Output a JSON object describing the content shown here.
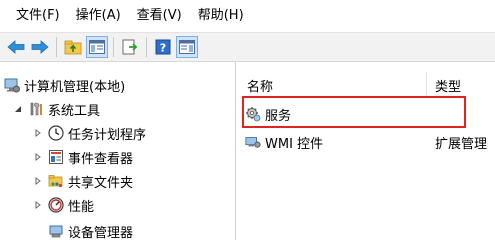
{
  "menu": {
    "file": "文件(F)",
    "action": "操作(A)",
    "view": "查看(V)",
    "help": "帮助(H)"
  },
  "toolbar": {
    "buttons": [
      "back-icon",
      "forward-icon",
      "up-folder-icon",
      "show-hide-tree-icon",
      "export-list-icon",
      "help-icon",
      "action-pane-icon"
    ]
  },
  "tree": {
    "root": "计算机管理(本地)",
    "system_tools": "系统工具",
    "task_scheduler": "任务计划程序",
    "event_viewer": "事件查看器",
    "shared_folders": "共享文件夹",
    "performance": "性能",
    "device_manager": "设备管理器"
  },
  "list": {
    "columns": [
      "名称",
      "类型"
    ],
    "rows": [
      {
        "name": "服务",
        "type": ""
      },
      {
        "name": "WMI 控件",
        "type": "扩展管理"
      }
    ]
  },
  "colors": {
    "highlight": "#e02424",
    "toolbar_bg": "#f2f2f2"
  }
}
